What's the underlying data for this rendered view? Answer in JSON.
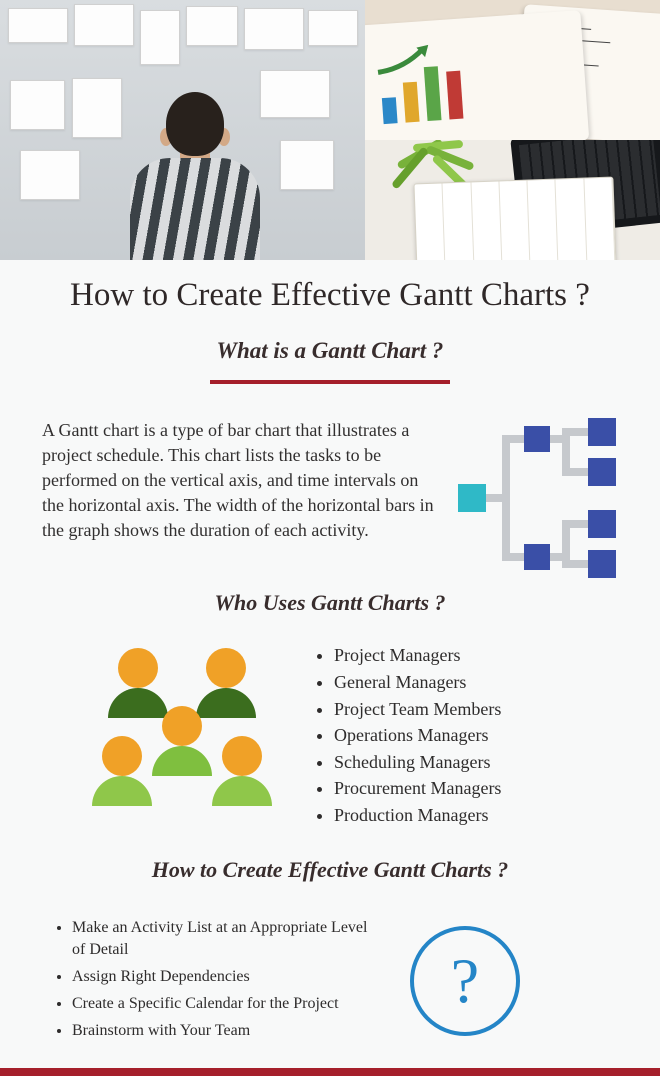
{
  "title": "How to Create Effective Gantt Charts ?",
  "section1": {
    "heading": "What is a Gantt Chart ?",
    "body": "A Gantt chart is a type of bar chart that illustrates a project schedule. This chart lists the tasks to be performed on the vertical axis, and time intervals on the horizontal axis. The width of the horizontal bars in the graph shows the duration of each activity."
  },
  "section2": {
    "heading": "Who Uses Gantt Charts ?",
    "items": [
      "Project Managers",
      "General Managers",
      "Project Team Members",
      "Operations Managers",
      "Scheduling Managers",
      "Procurement Managers",
      "Production Managers"
    ]
  },
  "section3": {
    "heading": "How to Create Effective Gantt Charts ?",
    "items": [
      "Make an Activity List at an Appropriate Level of Detail",
      "Assign Right Dependencies",
      "Create a Specific Calendar for the Project",
      "Brainstorm with Your Team"
    ],
    "qmark": "?"
  }
}
